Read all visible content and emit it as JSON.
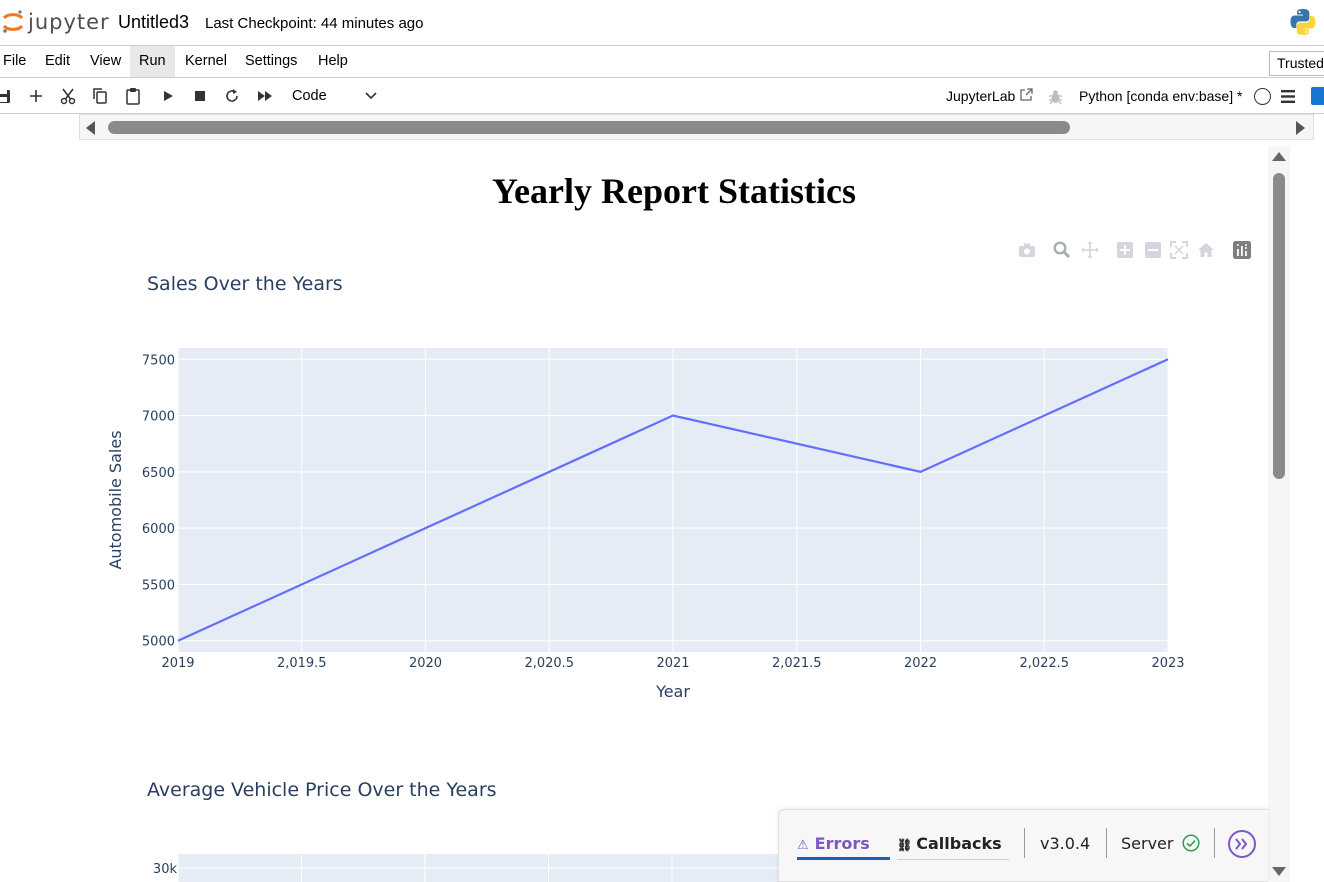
{
  "header": {
    "logo_text": "jupyter",
    "notebook_title": "Untitled3",
    "checkpoint": "Last Checkpoint: 44 minutes ago"
  },
  "menu": {
    "items": [
      "File",
      "Edit",
      "View",
      "Run",
      "Kernel",
      "Settings",
      "Help"
    ],
    "active": "Run",
    "trusted": "Trusted"
  },
  "toolbar": {
    "cell_type": "Code",
    "jupyterlab_link": "JupyterLab",
    "kernel": "Python [conda env:base] *",
    "icons": [
      "save-icon",
      "add-cell-icon",
      "cut-icon",
      "copy-icon",
      "paste-icon",
      "run-icon",
      "stop-icon",
      "restart-icon",
      "run-all-icon"
    ]
  },
  "report": {
    "title": "Yearly Report Statistics"
  },
  "modebar": {
    "icons": [
      "camera-icon",
      "zoom-icon",
      "pan-icon",
      "zoom-in-icon",
      "zoom-out-icon",
      "autoscale-icon",
      "reset-axes-icon",
      "plotly-logo-icon"
    ]
  },
  "chart_data": [
    {
      "type": "line",
      "title": "Sales Over the Years",
      "xlabel": "Year",
      "ylabel": "Automobile Sales",
      "x": [
        2019,
        2020,
        2021,
        2022,
        2023
      ],
      "y": [
        5000,
        6000,
        7000,
        6500,
        7500
      ],
      "xlim": [
        2019,
        2023
      ],
      "ylim": [
        4900,
        7600
      ],
      "x_ticks": [
        "2019",
        "2,019.5",
        "2020",
        "2,020.5",
        "2021",
        "2,021.5",
        "2022",
        "2,022.5",
        "2023"
      ],
      "y_ticks": [
        "5000",
        "5500",
        "6000",
        "6500",
        "7000",
        "7500"
      ],
      "line_color": "#636efa",
      "plot_bg": "#e5ecf6",
      "grid": true
    },
    {
      "type": "line",
      "title": "Average Vehicle Price Over the Years",
      "y_ticks": [
        "30k"
      ],
      "plot_bg": "#e5ecf6",
      "grid": true
    }
  ],
  "dash_debug": {
    "errors_label": "Errors",
    "callbacks_label": "Callbacks",
    "version": "v3.0.4",
    "server_label": "Server"
  },
  "colors": {
    "jupyter_orange": "#f37726",
    "plot_line": "#636efa",
    "plot_bg": "#e5ecf6",
    "axis_text": "#2a3f5f",
    "dash_purple": "#7e57c2"
  }
}
